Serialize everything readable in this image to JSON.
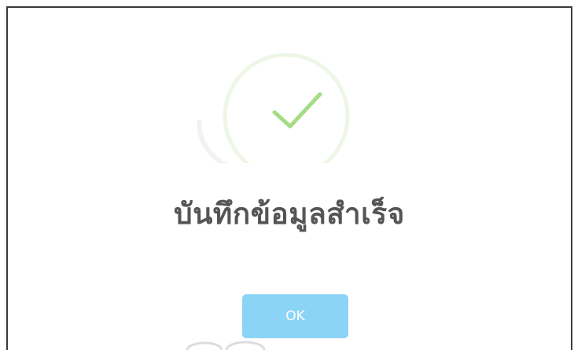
{
  "dialog": {
    "title": "บันทึกข้อมูลสำเร็จ",
    "ok_label": "OK",
    "icon": "success-check-icon"
  },
  "colors": {
    "check": "#a5dc86",
    "title": "#555555",
    "ok_button": "#8cd4f5",
    "border": "#3a3a3a"
  }
}
